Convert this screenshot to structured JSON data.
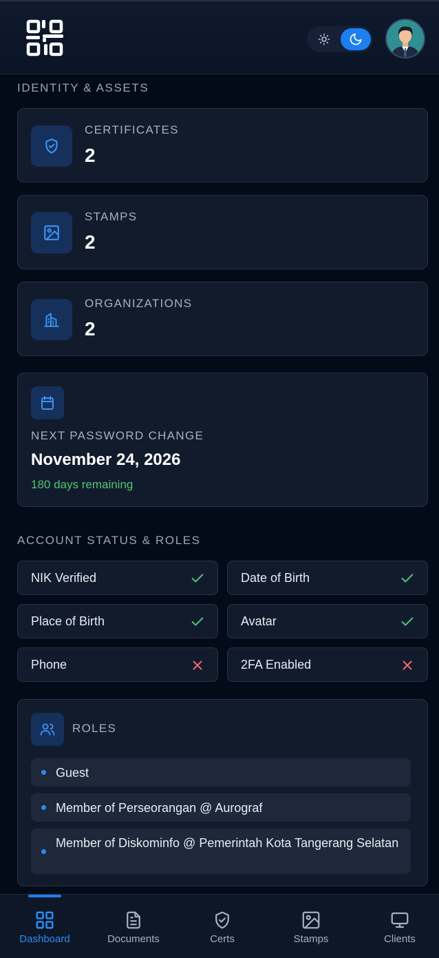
{
  "header": {
    "logo_icon": "qr-logo-icon",
    "theme": {
      "light_icon": "sun-icon",
      "dark_icon": "moon-icon",
      "active": "dark"
    },
    "avatar_icon": "user-avatar"
  },
  "identity": {
    "section_title": "IDENTITY & ASSETS",
    "stats": [
      {
        "label": "CERTIFICATES",
        "value": "2",
        "icon": "shield-check-icon"
      },
      {
        "label": "STAMPS",
        "value": "2",
        "icon": "image-icon"
      },
      {
        "label": "ORGANIZATIONS",
        "value": "2",
        "icon": "building-icon"
      }
    ]
  },
  "password": {
    "label": "NEXT PASSWORD CHANGE",
    "date": "November 24, 2026",
    "remaining": "180 days remaining",
    "icon": "calendar-icon"
  },
  "account": {
    "section_title": "ACCOUNT STATUS & ROLES",
    "statuses": [
      {
        "label": "NIK Verified",
        "ok": true
      },
      {
        "label": "Date of Birth",
        "ok": true
      },
      {
        "label": "Place of Birth",
        "ok": true
      },
      {
        "label": "Avatar",
        "ok": true
      },
      {
        "label": "Phone",
        "ok": false
      },
      {
        "label": "2FA Enabled",
        "ok": false
      }
    ]
  },
  "roles": {
    "title": "ROLES",
    "icon": "users-icon",
    "items": [
      "Guest",
      "Member of Perseorangan @ Aurograf",
      "Member of Diskominfo @ Pemerintah Kota Tangerang Selatan"
    ]
  },
  "nav": {
    "active": "Dashboard",
    "items": [
      {
        "label": "Dashboard",
        "icon": "grid-icon"
      },
      {
        "label": "Documents",
        "icon": "document-icon"
      },
      {
        "label": "Certs",
        "icon": "shield-check-icon"
      },
      {
        "label": "Stamps",
        "icon": "image-icon"
      },
      {
        "label": "Clients",
        "icon": "monitor-icon"
      }
    ]
  },
  "colors": {
    "accent": "#1d7ef0",
    "success": "#4ec776",
    "danger": "#f06a6a",
    "background": "#030a18",
    "card": "#121b2c"
  }
}
